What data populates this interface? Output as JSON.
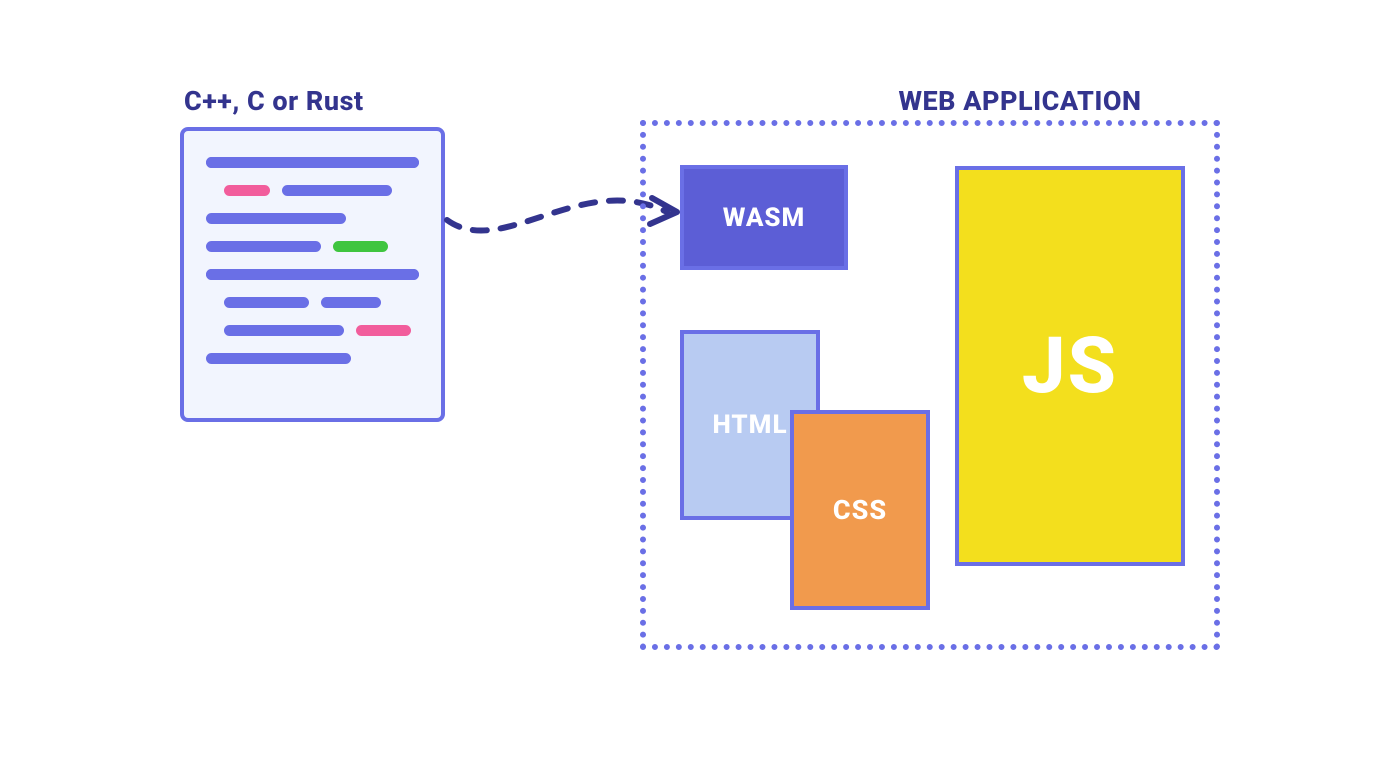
{
  "source": {
    "heading": "C++, C or Rust"
  },
  "app": {
    "heading": "WEB APPLICATION",
    "blocks": {
      "wasm": "WASM",
      "html": "HTML",
      "css": "CSS",
      "js": "JS"
    }
  },
  "colors": {
    "primary": "#6A6FE6",
    "heading": "#33348e",
    "pink": "#F25D9C",
    "green": "#3FC53F",
    "htmlFill": "#B8CBF2",
    "cssFill": "#F19A4D",
    "jsFill": "#F3DF1D",
    "wasmFill": "#5C5ED6",
    "docBg": "#F2F5FE"
  }
}
